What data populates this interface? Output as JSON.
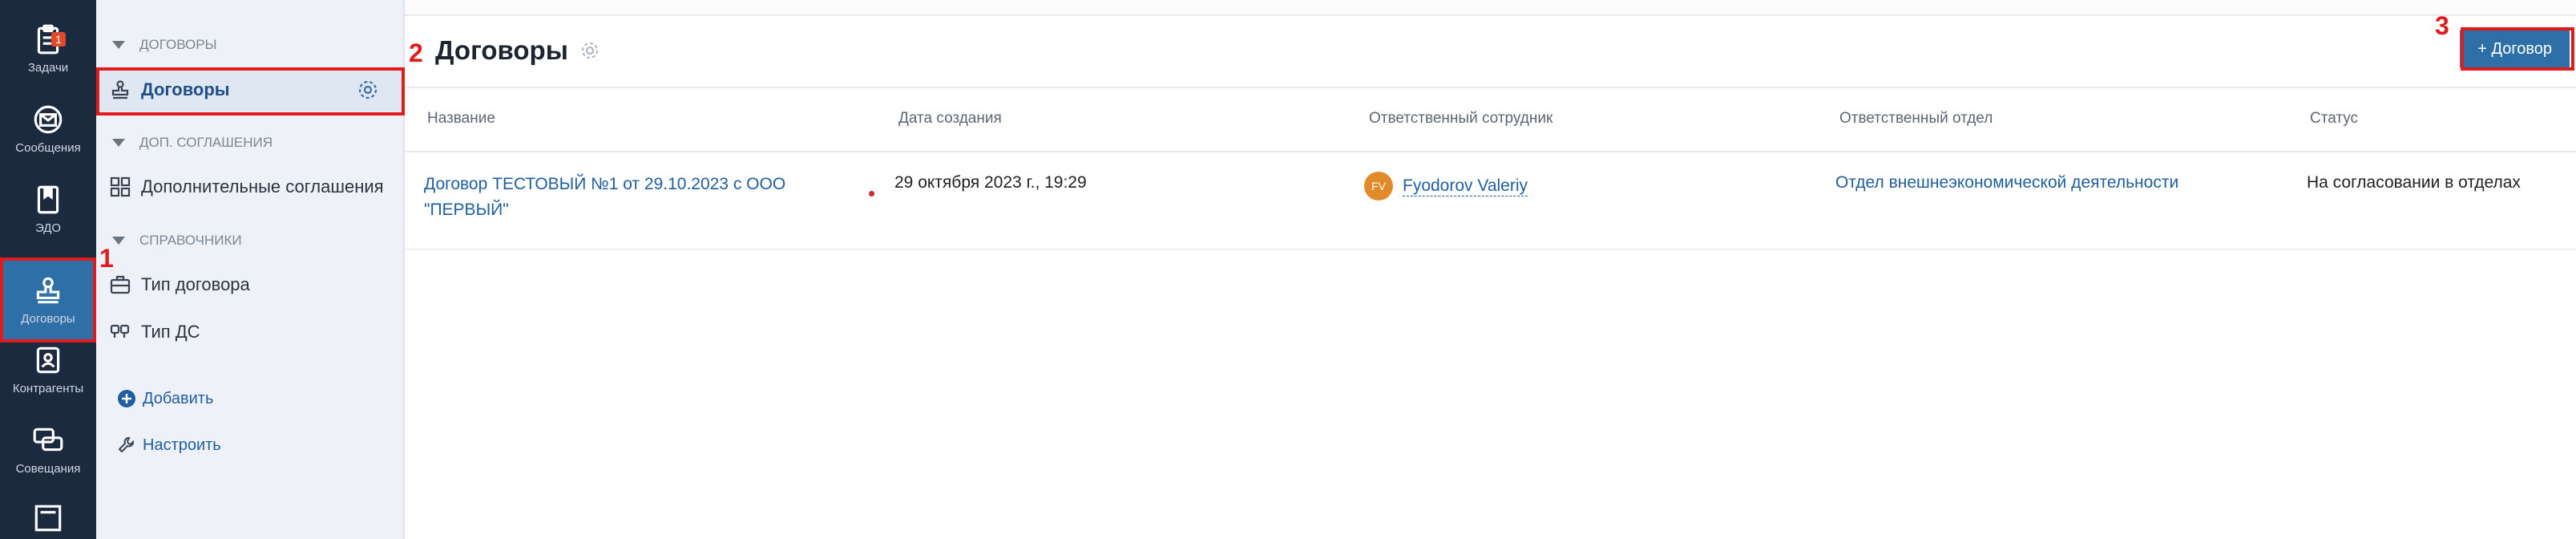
{
  "rail": {
    "items": [
      {
        "label": "Задачи",
        "badge": "1",
        "icon": "clipboard-icon"
      },
      {
        "label": "Сообщения",
        "icon": "mail-icon"
      },
      {
        "label": "ЭДО",
        "icon": "document-icon"
      },
      {
        "label": "Договоры",
        "icon": "stamp-icon"
      },
      {
        "label": "Контрагенты",
        "icon": "contact-card-icon"
      },
      {
        "label": "Совещания",
        "icon": "chat-bubbles-icon"
      }
    ]
  },
  "sidebar": {
    "sections": {
      "contracts": "ДОГОВОРЫ",
      "agreements": "ДОП. СОГЛАШЕНИЯ",
      "directories": "СПРАВОЧНИКИ"
    },
    "items": {
      "contracts": "Договоры",
      "agreements": "Дополнительные соглашения",
      "contract_type": "Тип договора",
      "ds_type": "Тип ДС"
    },
    "actions": {
      "add": "Добавить",
      "configure": "Настроить"
    }
  },
  "main": {
    "title": "Договоры",
    "add_button": "+ Договор",
    "columns": [
      "Название",
      "Дата создания",
      "Ответственный сотрудник",
      "Ответственный отдел",
      "Статус"
    ],
    "rows": [
      {
        "name_line1": "Договор ТЕСТОВЫЙ №1 от 29.10.2023 с ООО",
        "name_line2": "\"ПЕРВЫЙ\"",
        "created": "29 октября 2023 г., 19:29",
        "avatar": "FV",
        "employee": "Fyodorov Valeriy",
        "department": "Отдел внешнеэкономической деятельности",
        "status": "На согласовании в отделах"
      }
    ]
  },
  "annotations": [
    "1",
    "2",
    "3"
  ],
  "colors": {
    "accent": "#2f6fa8",
    "rail_bg": "#1c2a40",
    "annotation": "#e01b1b",
    "link": "#1f5fa0"
  }
}
